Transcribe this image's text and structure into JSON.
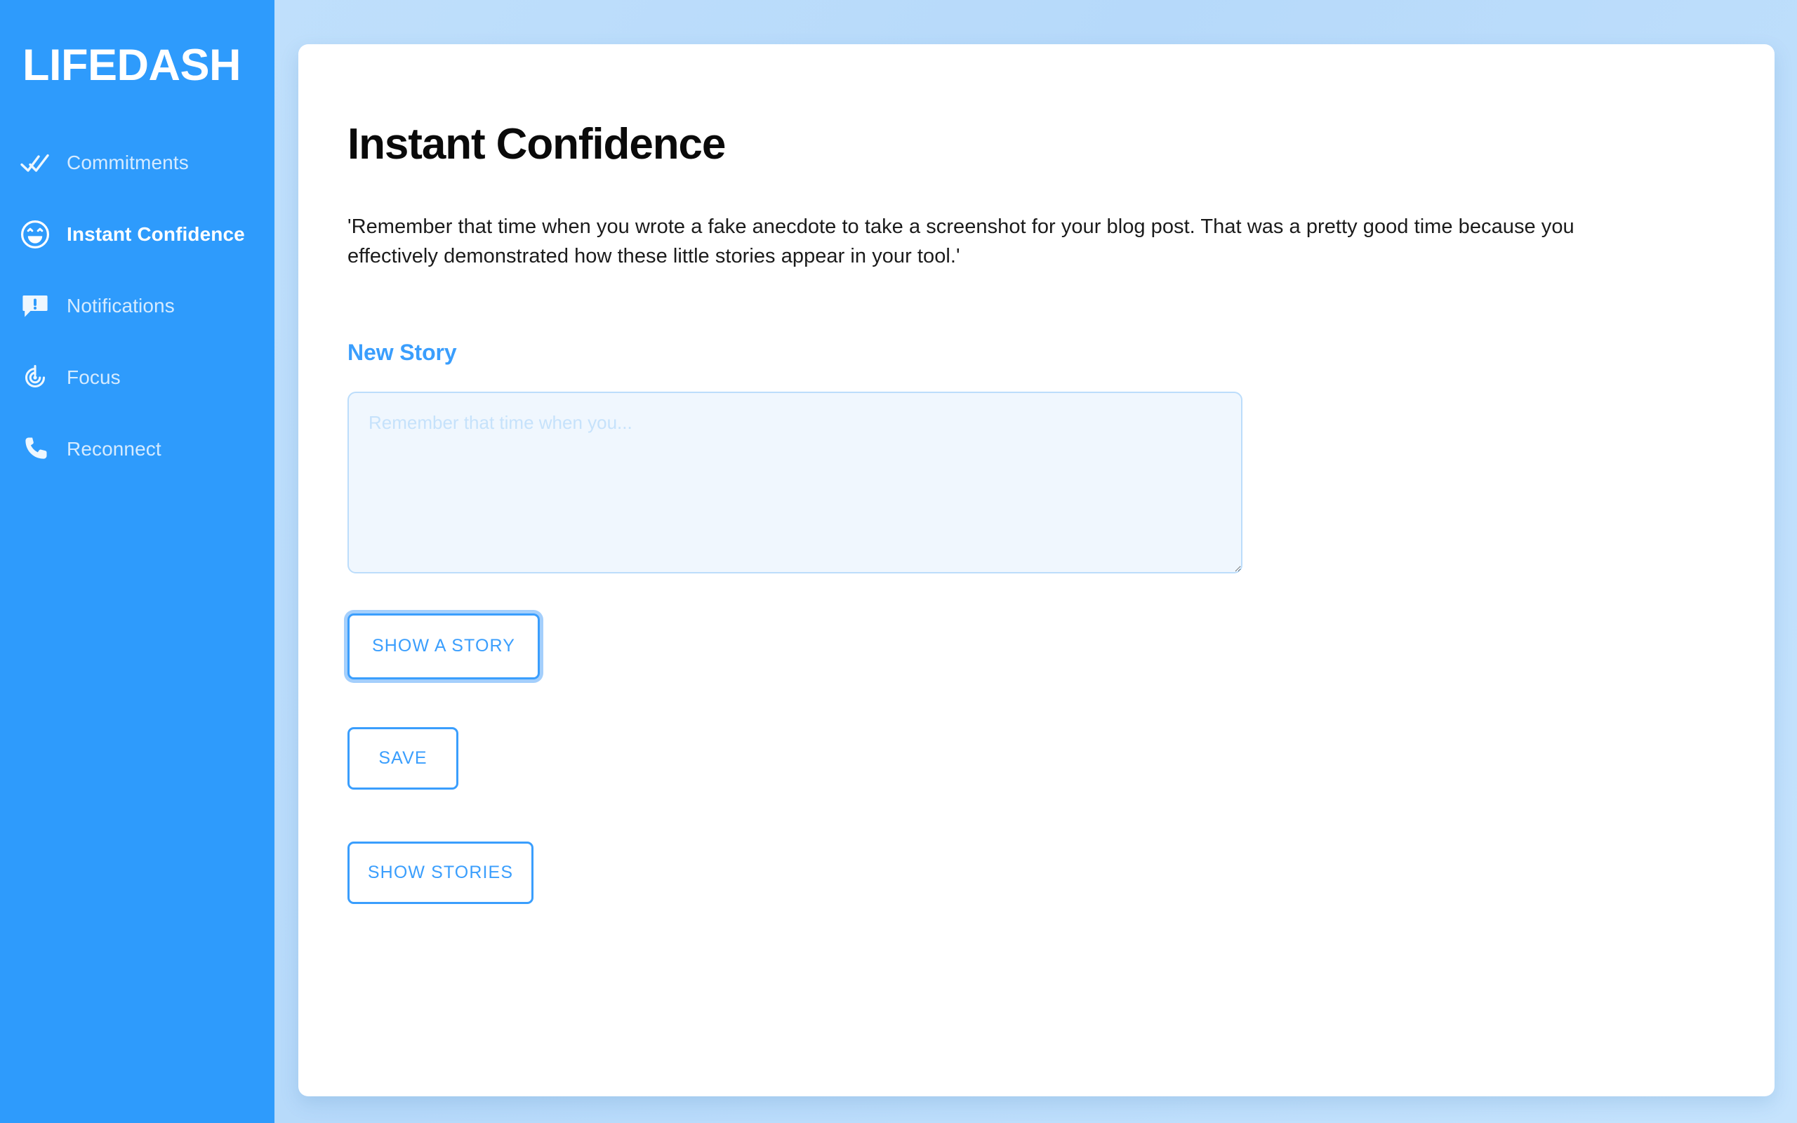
{
  "app": {
    "brand": "LIFEDASH",
    "accent_color": "#3a9efd",
    "sidebar_color": "#2e9bfc",
    "background_color": "#b9dcfb",
    "card_color": "#ffffff"
  },
  "sidebar": {
    "items": [
      {
        "label": "Commitments",
        "icon": "double-check-icon",
        "active": false
      },
      {
        "label": "Instant Confidence",
        "icon": "smiley-face-icon",
        "active": true
      },
      {
        "label": "Notifications",
        "icon": "chat-alert-icon",
        "active": false
      },
      {
        "label": "Focus",
        "icon": "target-power-icon",
        "active": false
      },
      {
        "label": "Reconnect",
        "icon": "phone-icon",
        "active": false
      }
    ]
  },
  "main": {
    "title": "Instant Confidence",
    "story_text": "'Remember that time when you wrote a fake anecdote to take a screenshot for your blog post. That was a pretty good time because you effectively demonstrated how these little stories appear in your tool.'",
    "new_story_label": "New Story",
    "textarea": {
      "placeholder": "Remember that time when you...",
      "value": ""
    },
    "buttons": {
      "show_a_story": "SHOW A STORY",
      "save": "SAVE",
      "show_stories": "SHOW STORIES"
    }
  }
}
